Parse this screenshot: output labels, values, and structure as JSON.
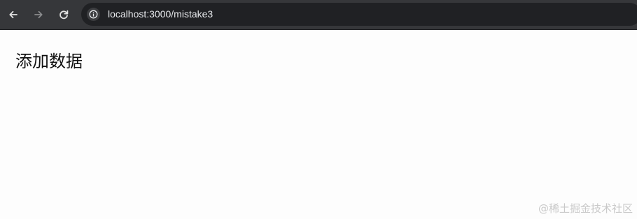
{
  "browser": {
    "url": "localhost:3000/mistake3",
    "icons": {
      "back": "arrow-left-icon",
      "forward": "arrow-right-icon",
      "reload": "reload-icon",
      "site_info": "info-icon"
    }
  },
  "page": {
    "heading": "添加数据"
  },
  "watermark": {
    "text": "@稀土掘金技术社区"
  },
  "colors": {
    "toolbar_bg": "#36373a",
    "omnibox_bg": "#202124",
    "url_text": "#e8eaed",
    "page_bg": "#fdfdfd",
    "heading_text": "#111111",
    "watermark_text": "#c9c9c9"
  }
}
